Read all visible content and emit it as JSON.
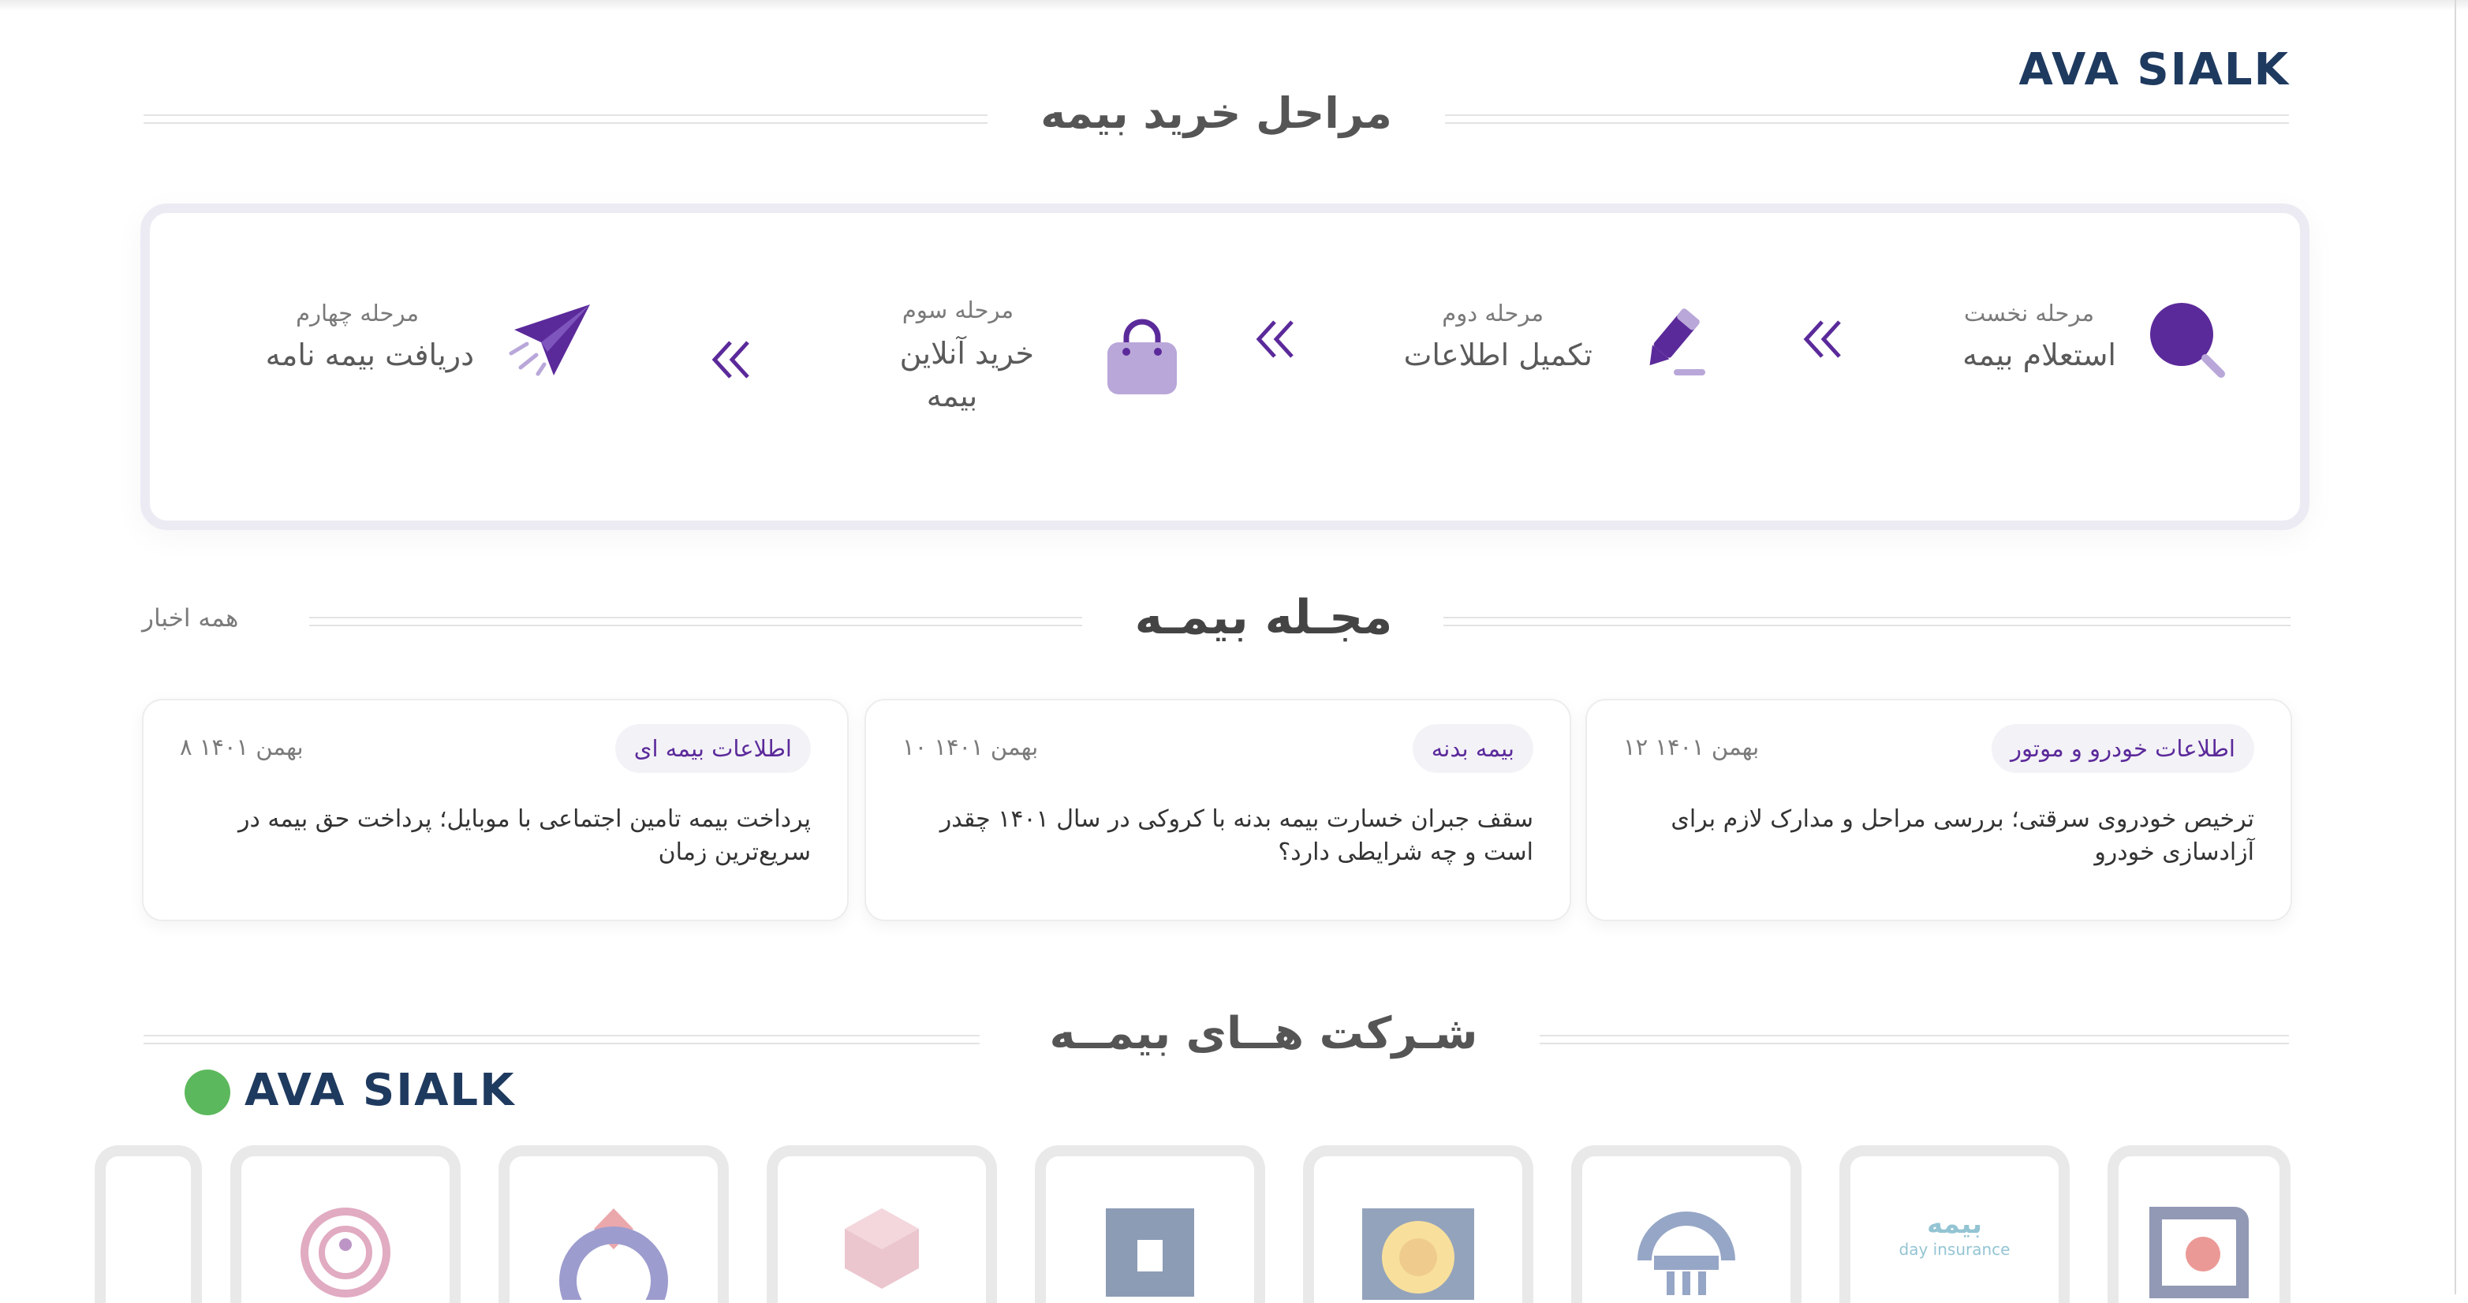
{
  "brand": {
    "text": "AVA SIALK"
  },
  "purchase": {
    "heading": "مراحل خرید بیمه",
    "steps": [
      {
        "label": "مرحله نخست",
        "title": "استعلام بیمه",
        "icon": "search-icon"
      },
      {
        "label": "مرحله دوم",
        "title": "تکمیل اطلاعات",
        "icon": "pencil-icon"
      },
      {
        "label": "مرحله سوم",
        "title_line1": "خرید آنلاین",
        "title_line2": "بیمه",
        "icon": "shopping-bag-icon"
      },
      {
        "label": "مرحله چهارم",
        "title": "دریافت بیمه نامه",
        "icon": "paper-plane-icon"
      }
    ],
    "accent": "#5b2a9a"
  },
  "magazine": {
    "heading": "مجـله بیمـه",
    "all_news": "همه اخبار",
    "cards": [
      {
        "tag": "اطلاعات خودرو و موتور",
        "date": "۱۲ بهمن ۱۴۰۱",
        "title": "ترخیص خودروی سرقتی؛ بررسی مراحل و مدارک لازم برای آزادسازی خودرو"
      },
      {
        "tag": "بیمه بدنه",
        "date": "۱۰ بهمن ۱۴۰۱",
        "title": "سقف جبران خسارت بیمه بدنه با کروکی در سال ۱۴۰۱ چقدر است و چه شرایطی دارد؟"
      },
      {
        "tag": "اطلاعات بیمه ای",
        "date": "۸ بهمن ۱۴۰۱",
        "title": "پرداخت بیمه تامین اجتماعی با موبایل؛ پرداخت حق بیمه در سریع‌ترین زمان"
      }
    ]
  },
  "companies": {
    "heading": "شـرکت هــای بیمــه",
    "brand": "AVA SIALK",
    "brand_dot_color": "#5cb85c",
    "day_insurance_fa": "بیمه",
    "day_insurance_en": "day insurance"
  }
}
